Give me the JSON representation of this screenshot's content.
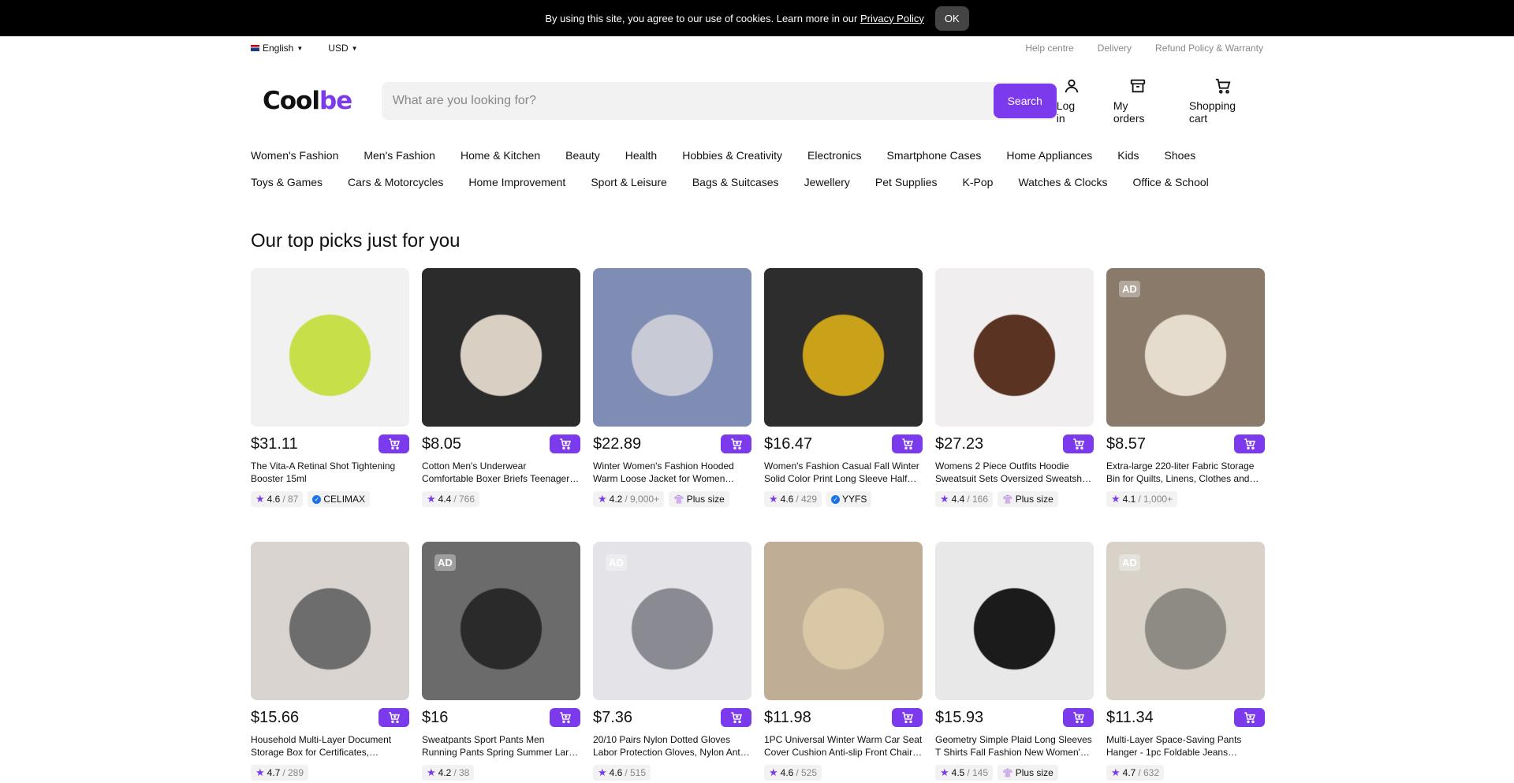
{
  "cookie": {
    "text": "By using this site, you agree to our use of cookies. Learn more in our",
    "link": "Privacy Policy",
    "ok": "OK"
  },
  "util": {
    "language": "English",
    "currency": "USD",
    "links": [
      "Help centre",
      "Delivery",
      "Refund Policy & Warranty"
    ]
  },
  "header": {
    "logo_a": "Cool",
    "logo_b": "be",
    "search_placeholder": "What are you looking for?",
    "search_button": "Search",
    "login": "Log in",
    "orders": "My orders",
    "cart": "Shopping cart"
  },
  "categories": {
    "row1": [
      "Women's Fashion",
      "Men's Fashion",
      "Home & Kitchen",
      "Beauty",
      "Health",
      "Hobbies & Creativity",
      "Electronics",
      "Smartphone Cases",
      "Home Appliances",
      "Kids",
      "Shoes"
    ],
    "row2": [
      "Toys & Games",
      "Cars & Motorcycles",
      "Home Improvement",
      "Sport & Leisure",
      "Bags & Suitcases",
      "Jewellery",
      "Pet Supplies",
      "K-Pop",
      "Watches & Clocks",
      "Office & School"
    ]
  },
  "section_title": "Our top picks just for you",
  "ad_label": "AD",
  "products": [
    {
      "price": "$31.11",
      "title": "The Vita-A Retinal Shot Tightening Booster 15ml",
      "rating": "4.6",
      "count": "/ 87",
      "badge": "CELIMAX",
      "badge_type": "verified",
      "ad": false,
      "bg": "#f1f1f1",
      "fg": "#c7e04a"
    },
    {
      "price": "$8.05",
      "title": "Cotton Men's Underwear Comfortable Boxer Briefs Teenager…",
      "rating": "4.4",
      "count": "/ 766",
      "badge": "",
      "badge_type": "",
      "ad": false,
      "bg": "#2b2b2b",
      "fg": "#d9cfc3"
    },
    {
      "price": "$22.89",
      "title": "Winter Women's Fashion Hooded Warm Loose Jacket for Women…",
      "rating": "4.2",
      "count": "/ 9,000+",
      "badge": "Plus size",
      "badge_type": "plus",
      "ad": false,
      "bg": "#7f8db5",
      "fg": "#c8cbd6"
    },
    {
      "price": "$16.47",
      "title": "Women's Fashion Casual Fall Winter Solid Color Print Long Sleeve Half…",
      "rating": "4.6",
      "count": "/ 429",
      "badge": "YYFS",
      "badge_type": "verified",
      "ad": false,
      "bg": "#2d2d2d",
      "fg": "#c9a21a"
    },
    {
      "price": "$27.23",
      "title": "Womens 2 Piece Outfits Hoodie Sweatsuit Sets Oversized Sweatsh…",
      "rating": "4.4",
      "count": "/ 166",
      "badge": "Plus size",
      "badge_type": "plus",
      "ad": false,
      "bg": "#f0eeee",
      "fg": "#5b3322"
    },
    {
      "price": "$8.57",
      "title": "Extra-large 220-liter Fabric Storage Bin for Quilts, Linens, Clothes and…",
      "rating": "4.1",
      "count": "/ 1,000+",
      "badge": "",
      "badge_type": "",
      "ad": true,
      "bg": "#8a7a6a",
      "fg": "#e6dccd"
    },
    {
      "price": "$15.66",
      "title": "Household Multi-Layer Document Storage Box for Certificates,…",
      "rating": "4.7",
      "count": "/ 289",
      "badge": "",
      "badge_type": "",
      "ad": false,
      "bg": "#d9d4cf",
      "fg": "#6d6d6d"
    },
    {
      "price": "$16",
      "title": "Sweatpants Sport Pants Men Running Pants Spring Summer Lar…",
      "rating": "4.2",
      "count": "/ 38",
      "badge": "",
      "badge_type": "",
      "ad": true,
      "bg": "#6b6b6b",
      "fg": "#2a2a2a"
    },
    {
      "price": "$7.36",
      "title": "20/10 Pairs Nylon Dotted Gloves Labor Protection Gloves, Nylon Ant…",
      "rating": "4.6",
      "count": "/ 515",
      "badge": "",
      "badge_type": "",
      "ad": true,
      "bg": "#e4e4e8",
      "fg": "#8a8a92"
    },
    {
      "price": "$11.98",
      "title": "1PC Universal Winter Warm Car Seat Cover Cushion Anti-slip Front Chair…",
      "rating": "4.6",
      "count": "/ 525",
      "badge": "",
      "badge_type": "",
      "ad": false,
      "bg": "#bfae95",
      "fg": "#d9c7a6"
    },
    {
      "price": "$15.93",
      "title": "Geometry Simple Plaid Long Sleeves T Shirts Fall Fashion New Women'…",
      "rating": "4.5",
      "count": "/ 145",
      "badge": "Plus size",
      "badge_type": "plus",
      "ad": false,
      "bg": "#e8e8e8",
      "fg": "#1b1b1b"
    },
    {
      "price": "$11.34",
      "title": "Multi-Layer Space-Saving Pants Hanger - 1pc Foldable Jeans…",
      "rating": "4.7",
      "count": "/ 632",
      "badge": "",
      "badge_type": "",
      "ad": true,
      "bg": "#d8d2c8",
      "fg": "#8e8a84"
    }
  ]
}
